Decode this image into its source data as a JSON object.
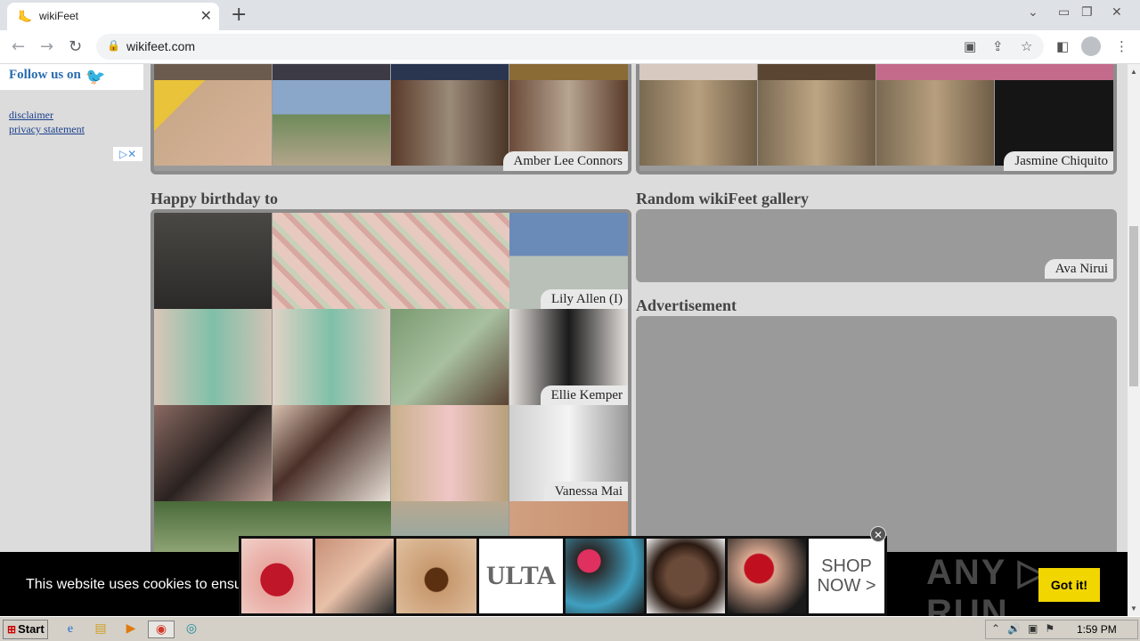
{
  "browser": {
    "tab_title": "wikiFeet",
    "tab_close": "✕",
    "new_tab": "+",
    "url": "wikifeet.com",
    "window_controls": [
      "minimize-icon",
      "restore-icon",
      "close-icon"
    ]
  },
  "sidebar": {
    "follow_text": "Follow us on",
    "links": [
      "disclaimer",
      "privacy statement"
    ]
  },
  "galleries_top": [
    {
      "caption": "Amber Lee Connors"
    },
    {
      "caption": "Jasmine Chiquito"
    }
  ],
  "headings": {
    "birthday": "Happy birthday to",
    "random": "Random wikiFeet gallery",
    "advertisement": "Advertisement"
  },
  "birthday_rows": [
    {
      "caption": "Lily Allen (I)"
    },
    {
      "caption": "Ellie Kemper"
    },
    {
      "caption": "Vanessa Mai"
    }
  ],
  "random_gallery": {
    "caption": "Ava Nirui"
  },
  "cookie": {
    "text": "This website uses cookies to ensure",
    "button": "Got it!"
  },
  "ad": {
    "brand": "ULTA",
    "cta_line1": "SHOP",
    "cta_line2": "NOW >",
    "close": "✕"
  },
  "watermark": "ANY ▷ RUN",
  "taskbar": {
    "start": "Start",
    "time": "1:59 PM"
  }
}
